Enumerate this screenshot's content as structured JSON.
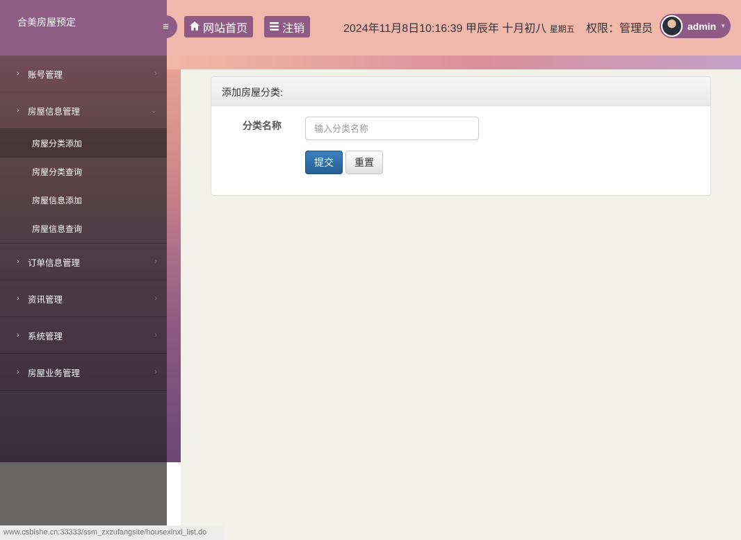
{
  "brand": {
    "title": "合美房屋预定"
  },
  "sidebar_toggle": {
    "icon": "menu-icon",
    "glyph": "≡"
  },
  "header": {
    "home_button": {
      "icon": "home-icon",
      "label": "网站首页"
    },
    "logout_button": {
      "icon": "menu-list-icon",
      "label": "注销"
    },
    "datetime": "2024年11月8日10:16:39 甲辰年 十月初八",
    "weekday": "星期五",
    "permission": "权限：管理员",
    "user": {
      "name": "admin"
    }
  },
  "sidebar": {
    "items": [
      {
        "label": "账号管理",
        "expanded": false
      },
      {
        "label": "房屋信息管理",
        "expanded": true,
        "children": [
          {
            "label": "房屋分类添加",
            "active": true
          },
          {
            "label": "房屋分类查询",
            "active": false
          },
          {
            "label": "房屋信息添加",
            "active": false
          },
          {
            "label": "房屋信息查询",
            "active": false
          }
        ]
      },
      {
        "label": "订单信息管理",
        "expanded": false
      },
      {
        "label": "资讯管理",
        "expanded": false
      },
      {
        "label": "系统管理",
        "expanded": false
      },
      {
        "label": "房屋业务管理",
        "expanded": false
      }
    ]
  },
  "panel": {
    "title": "添加房屋分类:",
    "field_label": "分类名称",
    "field_placeholder": "输入分类名称",
    "field_value": "",
    "submit_label": "提交",
    "reset_label": "重置"
  },
  "statusbar": {
    "url": "www.csbishe.cn:33333/ssm_zxzufangsite/housexinxi_list.do"
  },
  "colors": {
    "accent_purple": "#8f5b85",
    "header_pink": "#f0b7ad",
    "primary_button": "#2d6da3",
    "content_bg": "#f1f0e9"
  }
}
